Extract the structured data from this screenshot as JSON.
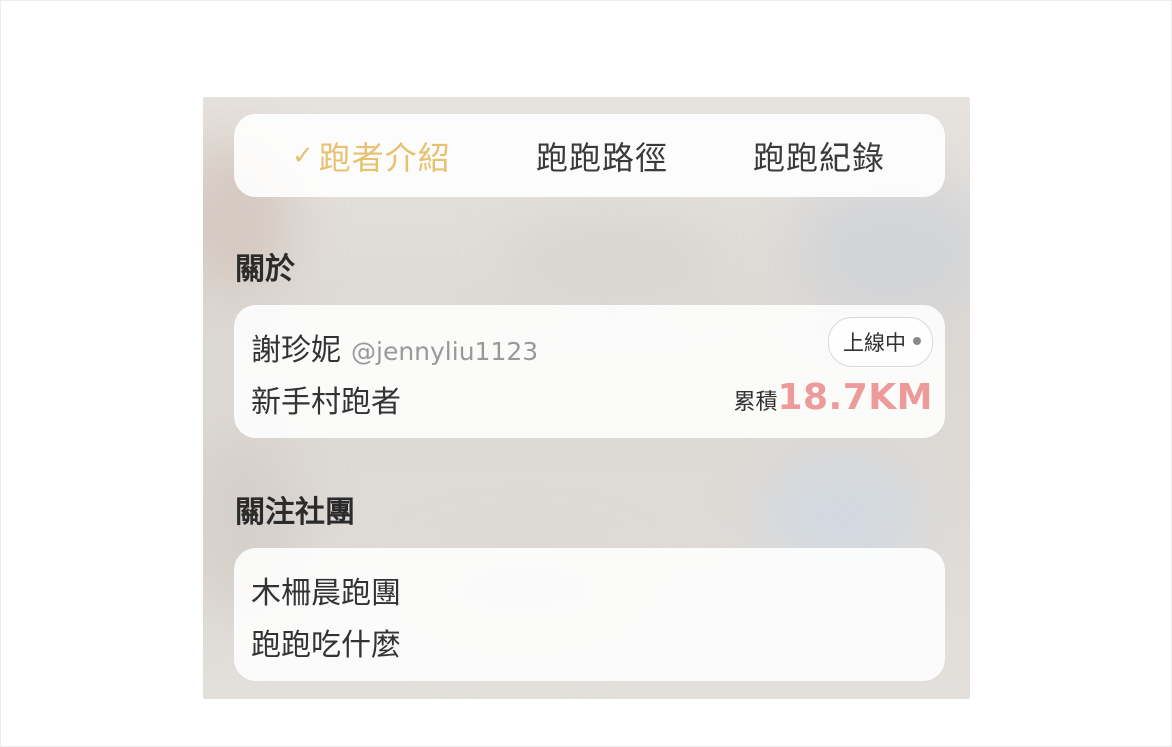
{
  "tabs": [
    {
      "label": "跑者介紹",
      "active": true,
      "check": "✓"
    },
    {
      "label": "跑跑路徑",
      "active": false
    },
    {
      "label": "跑跑紀錄",
      "active": false
    }
  ],
  "about": {
    "title": "關於",
    "name": "謝珍妮",
    "handle": "@jennyliu1123",
    "role": "新手村跑者",
    "status": "上線中",
    "total_label": "累積",
    "total_value": "18.7KM"
  },
  "clubs": {
    "title": "關注社團",
    "items": [
      "木柵晨跑團",
      "跑跑吃什麼"
    ]
  },
  "colors": {
    "active_tab": "#e7c172",
    "distance": "#ec9a9a",
    "status_dot": "#8a8a8a"
  },
  "icons": [
    "check-icon",
    "status-dot-icon"
  ]
}
